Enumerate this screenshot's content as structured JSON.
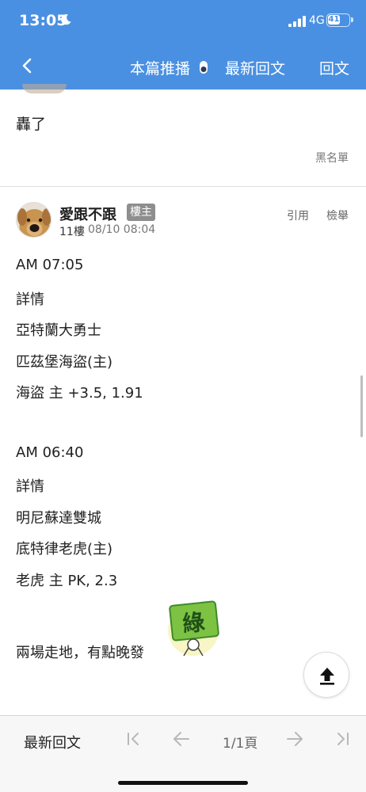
{
  "status_bar": {
    "time": "13:05",
    "network": "4G",
    "battery": "41"
  },
  "nav": {
    "title": "本篇推播",
    "latest_reply": "最新回文",
    "reply": "回文"
  },
  "previous_post": {
    "text": "轟了",
    "blacklist": "黑名單"
  },
  "post": {
    "username": "愛跟不跟",
    "op_badge": "樓主",
    "floor": "11樓",
    "date": "08/10 08:04",
    "quote": "引用",
    "report": "檢舉",
    "lines": [
      "AM 07:05",
      "詳情",
      "亞特蘭大勇士",
      "匹茲堡海盜(主)",
      "海盜 主 +3.5, 1.91",
      "AM 06:40",
      "詳情",
      "明尼蘇達雙城",
      "底特律老虎(主)",
      "老虎 主 PK, 2.3",
      "兩場走地，有點晚發"
    ],
    "sticker_char": "綠"
  },
  "footer": {
    "latest_reply": "最新回文",
    "page_indicator": "1/1頁"
  },
  "colors": {
    "header_bg": "#4a90e2",
    "badge_bg": "#8e8e8e"
  },
  "icons": [
    "moon-icon",
    "signal-icon",
    "battery-icon",
    "back-chevron-icon",
    "toggle-icon",
    "scroll-top-icon",
    "first-page-icon",
    "prev-page-icon",
    "next-page-icon",
    "last-page-icon"
  ]
}
